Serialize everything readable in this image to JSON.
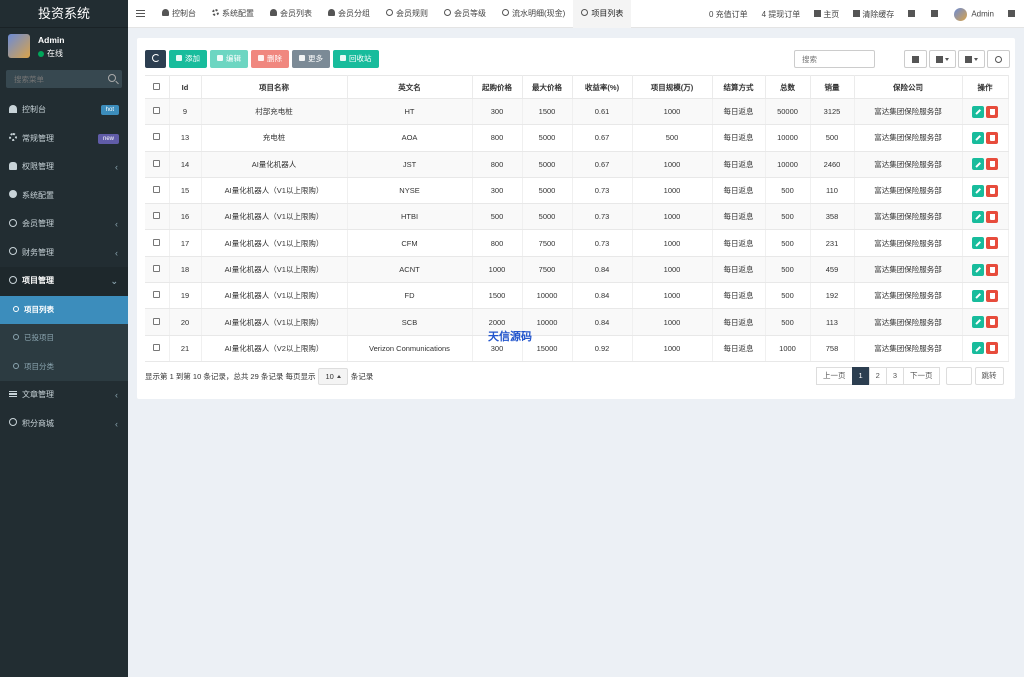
{
  "brand": "投资系统",
  "user": {
    "name": "Admin",
    "status": "在线"
  },
  "sidebar_search_placeholder": "搜索菜单",
  "sidebar": [
    {
      "label": "控制台",
      "icon": "dashboard-icon",
      "badge": "hot"
    },
    {
      "label": "常规管理",
      "icon": "gear-icon",
      "badge": "new"
    },
    {
      "label": "权限管理",
      "icon": "users-icon",
      "chev": "‹"
    },
    {
      "label": "系统配置",
      "icon": "cog-icon"
    },
    {
      "label": "会员管理",
      "icon": "user-icon",
      "chev": "‹"
    },
    {
      "label": "财务管理",
      "icon": "circle-icon",
      "chev": "‹"
    },
    {
      "label": "项目管理",
      "icon": "circle-icon",
      "chev": "⌄"
    },
    {
      "label": "项目列表",
      "icon": "circle-icon"
    },
    {
      "label": "已投项目",
      "icon": "circle-icon"
    },
    {
      "label": "项目分类",
      "icon": "circle-icon"
    },
    {
      "label": "文章管理",
      "icon": "bars-icon",
      "chev": "‹"
    },
    {
      "label": "积分商城",
      "icon": "circle-icon",
      "chev": "‹"
    }
  ],
  "tabs": [
    {
      "label": "控制台",
      "icon": "dashboard-icon"
    },
    {
      "label": "系统配置",
      "icon": "gear-icon"
    },
    {
      "label": "会员列表",
      "icon": "user-icon"
    },
    {
      "label": "会员分组",
      "icon": "users-icon"
    },
    {
      "label": "会员规则",
      "icon": "circle-icon"
    },
    {
      "label": "会员等级",
      "icon": "circle-icon"
    },
    {
      "label": "流水明细(现金)",
      "icon": "circle-icon"
    },
    {
      "label": "项目列表",
      "icon": "circle-icon"
    }
  ],
  "nav_right": {
    "recharge": "0 充值订单",
    "withdraw": "4 提现订单",
    "home": "主页",
    "clear_cache": "清除缓存",
    "admin": "Admin"
  },
  "toolbar": {
    "add": "添加",
    "edit": "编辑",
    "delete": "删除",
    "more": "更多",
    "recycle": "回收站",
    "search_placeholder": "搜索"
  },
  "table": {
    "headers": [
      "Id",
      "项目名称",
      "英文名",
      "起购价格",
      "最大价格",
      "收益率(%)",
      "项目规模(万)",
      "结算方式",
      "总数",
      "销量",
      "保险公司",
      "操作"
    ],
    "rows": [
      [
        "9",
        "村部充电桩",
        "HT",
        "300",
        "1500",
        "0.61",
        "1000",
        "每日返息",
        "50000",
        "3125",
        "富达集团保险服务部"
      ],
      [
        "13",
        "充电桩",
        "AOA",
        "800",
        "5000",
        "0.67",
        "500",
        "每日返息",
        "10000",
        "500",
        "富达集团保险服务部"
      ],
      [
        "14",
        "AI量化机器人",
        "JST",
        "800",
        "5000",
        "0.67",
        "1000",
        "每日返息",
        "10000",
        "2460",
        "富达集团保险服务部"
      ],
      [
        "15",
        "AI量化机器人（V1以上限购）",
        "NYSE",
        "300",
        "5000",
        "0.73",
        "1000",
        "每日返息",
        "500",
        "110",
        "富达集团保险服务部"
      ],
      [
        "16",
        "AI量化机器人（V1以上限购）",
        "HTBI",
        "500",
        "5000",
        "0.73",
        "1000",
        "每日返息",
        "500",
        "358",
        "富达集团保险服务部"
      ],
      [
        "17",
        "AI量化机器人（V1以上限购）",
        "CFM",
        "800",
        "7500",
        "0.73",
        "1000",
        "每日返息",
        "500",
        "231",
        "富达集团保险服务部"
      ],
      [
        "18",
        "AI量化机器人（V1以上限购）",
        "ACNT",
        "1000",
        "7500",
        "0.84",
        "1000",
        "每日返息",
        "500",
        "459",
        "富达集团保险服务部"
      ],
      [
        "19",
        "AI量化机器人（V1以上限购）",
        "FD",
        "1500",
        "10000",
        "0.84",
        "1000",
        "每日返息",
        "500",
        "192",
        "富达集团保险服务部"
      ],
      [
        "20",
        "AI量化机器人（V1以上限购）",
        "SCB",
        "2000",
        "10000",
        "0.84",
        "1000",
        "每日返息",
        "500",
        "113",
        "富达集团保险服务部"
      ],
      [
        "21",
        "AI量化机器人（V2以上限购）",
        "Verizon Conmunications",
        "300",
        "15000",
        "0.92",
        "1000",
        "每日返息",
        "1000",
        "758",
        "富达集团保险服务部"
      ]
    ]
  },
  "pager": {
    "info_prefix": "显示第 1 到第 10 条记录，总共 29 条记录 每页显示",
    "page_size": "10",
    "info_suffix": "条记录",
    "prev": "上一页",
    "pages": [
      "1",
      "2",
      "3"
    ],
    "next": "下一页",
    "jump": "跳转"
  },
  "watermark": "天信源码",
  "colors": {
    "accent": "#3c8dbc",
    "sidebar_bg": "#222d32",
    "success": "#18bc9c",
    "danger": "#e74c3c"
  }
}
